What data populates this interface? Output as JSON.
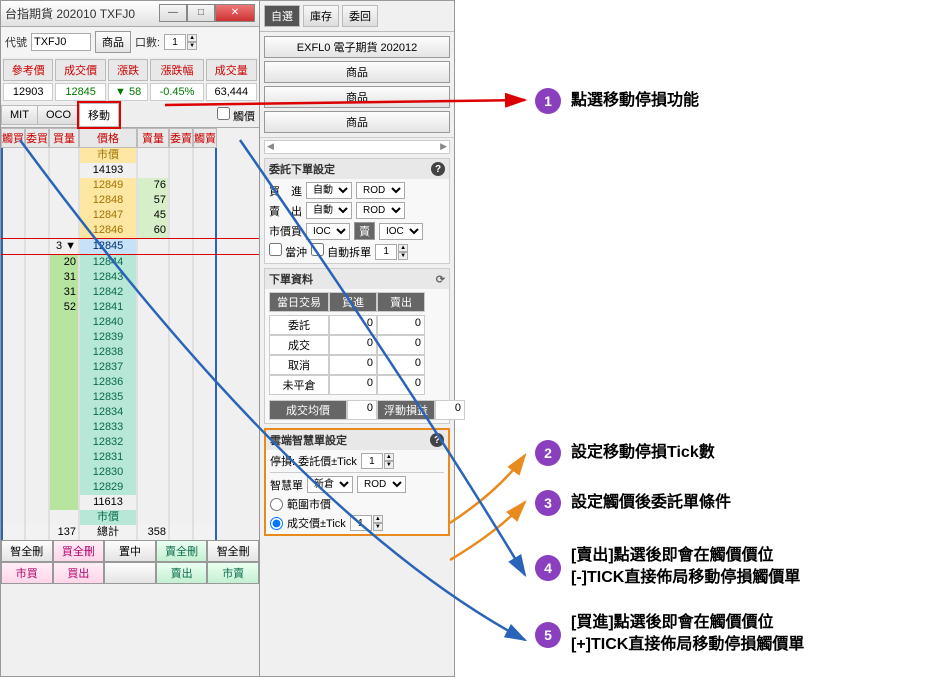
{
  "window": {
    "title": "台指期貨 202010 TXFJ0"
  },
  "top_form": {
    "code_label": "代號",
    "code_value": "TXFJ0",
    "product_btn": "商品",
    "lots_label": "口數:",
    "lots_value": "1"
  },
  "quote_header": {
    "cols": [
      "參考價",
      "成交價",
      "漲跌",
      "漲跌幅",
      "成交量"
    ],
    "vals": [
      "12903",
      "12845",
      "58",
      "-0.45%",
      "63,444"
    ],
    "arrow": "▼"
  },
  "tabs": {
    "items": [
      "MIT",
      "OCO",
      "移動"
    ],
    "active": 2,
    "extra_label": "觸價"
  },
  "dom": {
    "headers": [
      "觸買",
      "委買",
      "買量",
      "價格",
      "賣量",
      "委賣",
      "觸賣"
    ],
    "market_label": "市價",
    "top_price": "14193",
    "asks": [
      {
        "price": "12849",
        "vol": "76"
      },
      {
        "price": "12848",
        "vol": "57"
      },
      {
        "price": "12847",
        "vol": "45"
      },
      {
        "price": "12846",
        "vol": "60"
      }
    ],
    "current_price": "12845",
    "current_marker": "3 ▼",
    "bids": [
      {
        "vol": "20",
        "price": "12844"
      },
      {
        "vol": "31",
        "price": "12843"
      },
      {
        "vol": "31",
        "price": "12842"
      },
      {
        "vol": "52",
        "price": "12841"
      },
      {
        "vol": "",
        "price": "12840"
      },
      {
        "vol": "",
        "price": "12839"
      },
      {
        "vol": "",
        "price": "12838"
      },
      {
        "vol": "",
        "price": "12837"
      },
      {
        "vol": "",
        "price": "12836"
      },
      {
        "vol": "",
        "price": "12835"
      },
      {
        "vol": "",
        "price": "12834"
      },
      {
        "vol": "",
        "price": "12833"
      },
      {
        "vol": "",
        "price": "12832"
      },
      {
        "vol": "",
        "price": "12831"
      },
      {
        "vol": "",
        "price": "12830"
      },
      {
        "vol": "",
        "price": "12829"
      }
    ],
    "low_price": "11613",
    "market_label2": "市價",
    "total_row": {
      "buy": "137",
      "label": "總計",
      "sell": "358"
    }
  },
  "bottom_btns": {
    "row1": [
      "智全刪",
      "買全刪",
      "置中",
      "賣全刪",
      "智全刪"
    ],
    "row2": [
      "市買",
      "買出",
      "",
      "賣出",
      "市賣"
    ]
  },
  "mid_tabs": {
    "items": [
      "自選",
      "庫存",
      "委回"
    ],
    "active": 0
  },
  "mid_list": {
    "first": "EXFL0 電子期貨 202012",
    "items": [
      "商品",
      "商品",
      "商品"
    ]
  },
  "order_settings": {
    "title": "委託下單設定",
    "buy_label": "買　進",
    "sell_label": "賣　出",
    "auto": "自動",
    "rod": "ROD",
    "mkt_label": "市價買",
    "ioc": "IOC",
    "sell_mkt_btn": "賣",
    "daytrade_chk": "當沖",
    "autosplit_chk": "自動拆單",
    "autosplit_val": "1"
  },
  "order_data": {
    "title": "下單資料",
    "header": [
      "當日交易",
      "買進",
      "賣出"
    ],
    "rows": [
      {
        "k": "委託",
        "b": "0",
        "s": "0"
      },
      {
        "k": "成交",
        "b": "0",
        "s": "0"
      },
      {
        "k": "取消",
        "b": "0",
        "s": "0"
      },
      {
        "k": "未平倉",
        "b": "0",
        "s": "0"
      }
    ],
    "avg_label": "成交均價",
    "avg_val": "0",
    "pl_label": "浮動損益",
    "pl_val": "0"
  },
  "smart": {
    "title": "雲端智慧單設定",
    "stop_label": "停損: 委託價±Tick",
    "stop_val": "1",
    "smartorder_label": "智慧單",
    "pos_sel": "新倉",
    "rod": "ROD",
    "radio_range": "範圍市價",
    "radio_deal": "成交價±Tick",
    "deal_val": "1"
  },
  "annotations": {
    "a1": "點選移動停損功能",
    "a2": "設定移動停損Tick數",
    "a3": "設定觸價後委託單條件",
    "a4": "[賣出]點選後即會在觸價價位\n[-]TICK直接佈局移動停損觸價單",
    "a5": "[買進]點選後即會在觸價價位\n[+]TICK直接佈局移動停損觸價單"
  }
}
